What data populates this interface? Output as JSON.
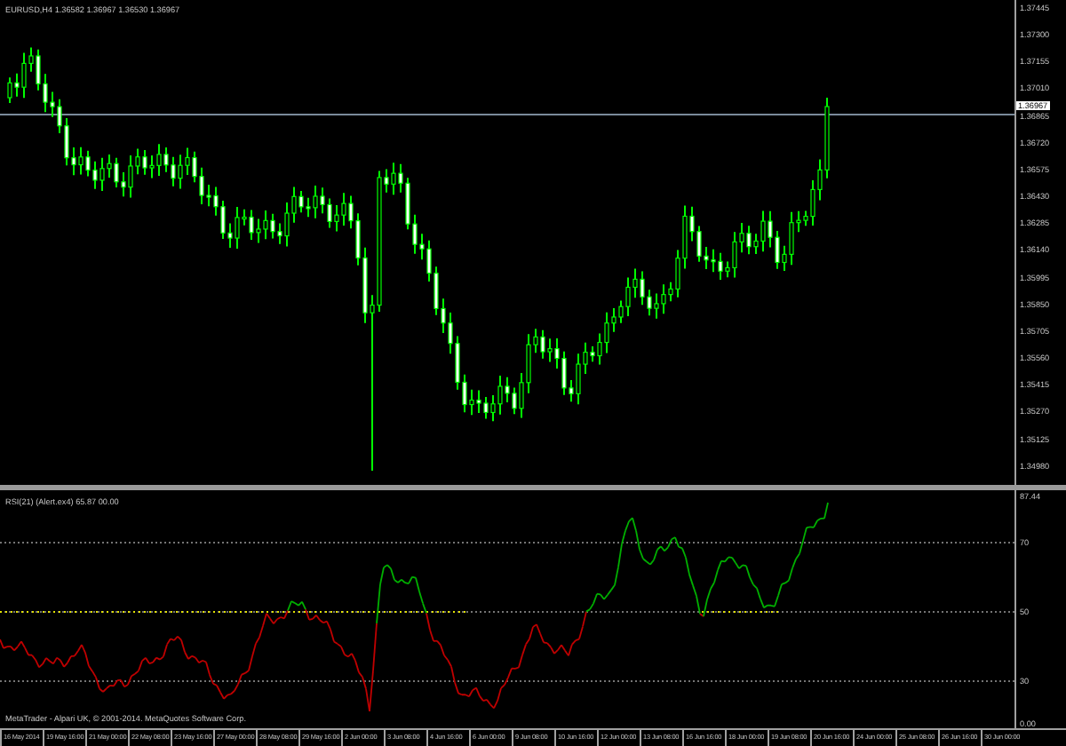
{
  "chart": {
    "symbol_info": "EURUSD,H4  1.36582 1.36967 1.36530 1.36967",
    "current_price": "1.36967",
    "price_axis": [
      "1.37445",
      "1.37300",
      "1.37155",
      "1.37010",
      "1.36865",
      "1.36720",
      "1.36575",
      "1.36430",
      "1.36285",
      "1.36140",
      "1.35995",
      "1.35850",
      "1.35705",
      "1.35560",
      "1.35415",
      "1.35270",
      "1.35125",
      "1.34980"
    ]
  },
  "indicator": {
    "label": "RSI(21) (Alert.ex4) 65.87 00.00",
    "copyright": "MetaTrader - Alpari UK, © 2001-2014. MetaQuotes Software Corp.",
    "axis": [
      "87.44",
      "70",
      "50",
      "30",
      "0.00"
    ]
  },
  "time_axis": [
    "16 May 2014",
    "19 May 16:00",
    "21 May 00:00",
    "22 May 08:00",
    "23 May 16:00",
    "27 May 00:00",
    "28 May 08:00",
    "29 May 16:00",
    "2 Jun 00:00",
    "3 Jun 08:00",
    "4 Jun 16:00",
    "6 Jun 00:00",
    "9 Jun 08:00",
    "10 Jun 16:00",
    "12 Jun 00:00",
    "13 Jun 08:00",
    "16 Jun 16:00",
    "18 Jun 00:00",
    "19 Jun 08:00",
    "20 Jun 16:00",
    "24 Jun 00:00",
    "25 Jun 08:00",
    "26 Jun 16:00",
    "30 Jun 00:00"
  ]
}
